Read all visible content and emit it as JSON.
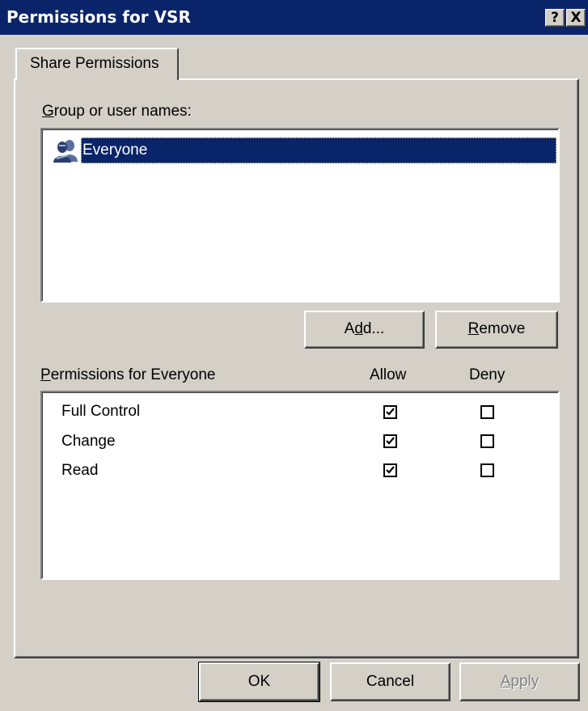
{
  "window": {
    "title": "Permissions for VSR",
    "help_label": "?",
    "close_label": "X"
  },
  "tabs": [
    {
      "label": "Share Permissions",
      "selected": true
    }
  ],
  "group_section": {
    "label_prefix": "",
    "label_accel": "G",
    "label_rest": "roup or user names:",
    "users": [
      {
        "name": "Everyone",
        "icon": "user-group-icon",
        "selected": true
      }
    ]
  },
  "buttons": {
    "add": {
      "pre": "A",
      "accel": "d",
      "post": "d..."
    },
    "remove": {
      "pre": "",
      "accel": "R",
      "post": "emove"
    },
    "ok": "OK",
    "cancel": "Cancel",
    "apply": {
      "pre": "",
      "accel": "A",
      "post": "pply",
      "disabled": true
    }
  },
  "permissions": {
    "label_accel": "P",
    "label_rest": "ermissions for Everyone",
    "allow_header": "Allow",
    "deny_header": "Deny",
    "rows": [
      {
        "name": "Full Control",
        "allow": true,
        "deny": false
      },
      {
        "name": "Change",
        "allow": true,
        "deny": false
      },
      {
        "name": "Read",
        "allow": true,
        "deny": false
      }
    ]
  },
  "colors": {
    "titlebar": "#0a246a",
    "face": "#d4d0c8",
    "selection": "#0a246a"
  }
}
